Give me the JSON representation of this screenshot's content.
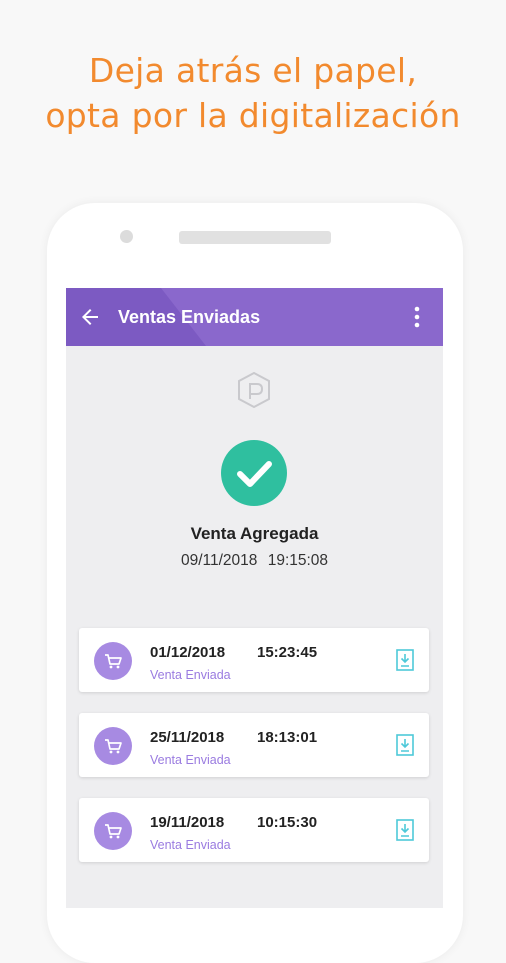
{
  "headline": {
    "line1": "Deja atrás el papel,",
    "line2": "opta por la digitalización"
  },
  "colors": {
    "headline": "#f28a2e",
    "appbar": "#8a68cc",
    "success": "#2fbf9f",
    "avatar": "#a78ae2",
    "status_text": "#9a7be0",
    "doc_icon": "#4ec9d9"
  },
  "appbar": {
    "title": "Ventas Enviadas",
    "back_icon": "arrow-left-icon",
    "menu_icon": "more-vert-icon"
  },
  "confirmation": {
    "icon": "check-icon",
    "title": "Venta Agregada",
    "date": "09/11/2018",
    "time": "19:15:08"
  },
  "sales": [
    {
      "date": "01/12/2018",
      "time": "15:23:45",
      "status": "Venta Enviada",
      "icon": "cart-icon",
      "action_icon": "document-download-icon"
    },
    {
      "date": "25/11/2018",
      "time": "18:13:01",
      "status": "Venta Enviada",
      "icon": "cart-icon",
      "action_icon": "document-download-icon"
    },
    {
      "date": "19/11/2018",
      "time": "10:15:30",
      "status": "Venta Enviada",
      "icon": "cart-icon",
      "action_icon": "document-download-icon"
    }
  ]
}
